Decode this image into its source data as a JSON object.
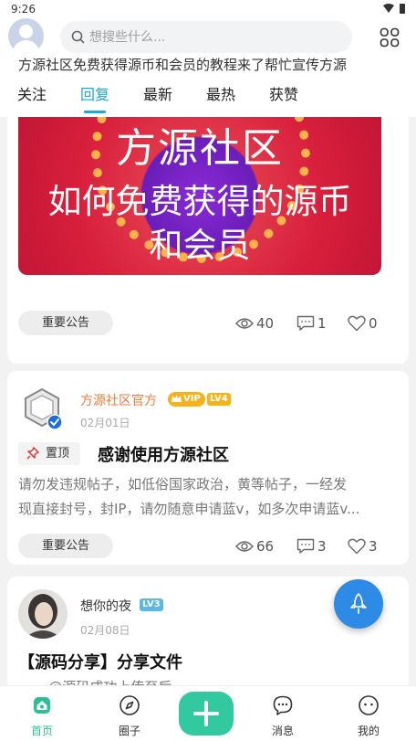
{
  "status_bar": {
    "time": "9:26"
  },
  "header": {
    "search_placeholder": "想搜些什么...",
    "announcement": "方源社区免费获得源币和会员的教程来了帮忙宣传方源"
  },
  "tabs": [
    {
      "label": "关注"
    },
    {
      "label": "回复",
      "active": true
    },
    {
      "label": "最新"
    },
    {
      "label": "最热"
    },
    {
      "label": "获赞"
    }
  ],
  "posts": [
    {
      "banner": {
        "line1": "方源社区",
        "line2": "如何免费获得的源币",
        "line3": "和会员"
      },
      "tag": "重要公告",
      "views": "40",
      "comments": "1",
      "likes": "0"
    },
    {
      "author": "方源社区官方",
      "vip_badge": "VIP",
      "level": "LV4",
      "date": "02月01日",
      "pin_label": "置顶",
      "title": "感谢使用方源社区",
      "body_line1": "请勿发违规帖子，如低俗国家政治，黄等帖子，一经发",
      "body_line2": "现直接封号，封IP，请勿随意申请蓝v，如多次申请蓝v...",
      "tag": "重要公告",
      "views": "66",
      "comments": "3",
      "likes": "3"
    },
    {
      "author": "想你的夜",
      "level": "LV3",
      "date": "02月08日",
      "title": "【源码分享】分享文件",
      "body_partial": "...... @源码成功上传至后..."
    }
  ],
  "bottom_nav": [
    {
      "label": "首页",
      "icon": "home-icon",
      "active": true
    },
    {
      "label": "圈子",
      "icon": "compass-icon"
    },
    {
      "label": "",
      "icon": "plus-icon"
    },
    {
      "label": "消息",
      "icon": "message-icon"
    },
    {
      "label": "我的",
      "icon": "profile-icon"
    }
  ],
  "colors": {
    "accent": "#1aa9d8",
    "nav_active": "#2bbf96",
    "fab": "#2d8be6",
    "vip": "#f5b21c",
    "author_official": "#f07a3a"
  }
}
